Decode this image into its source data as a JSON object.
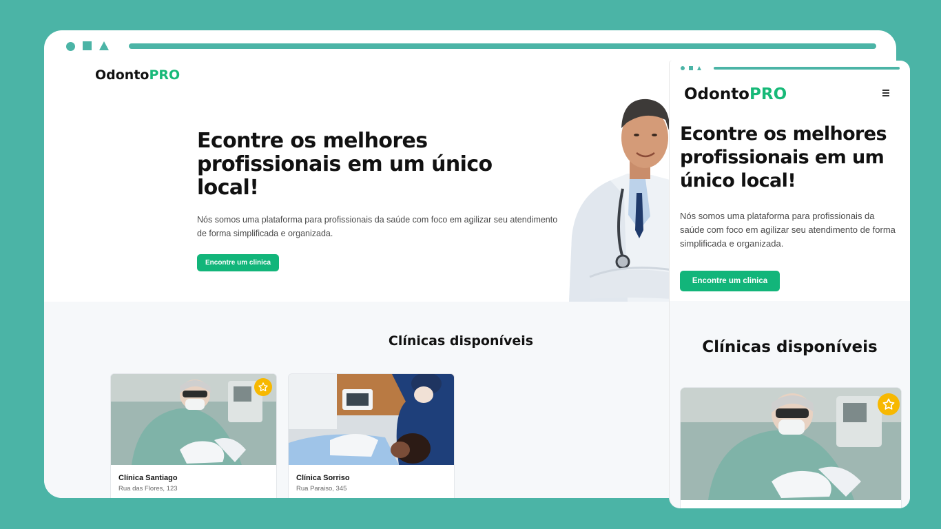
{
  "brand": {
    "name_prefix": "Odonto",
    "name_suffix": "PRO"
  },
  "hero": {
    "title": "Econtre os melhores profissionais em um único local!",
    "description": "Nós somos uma plataforma para profissionais da saúde com foco em agilizar seu atendimento de forma simplificada e organizada.",
    "cta_label": "Encontre um clinica"
  },
  "clinics_section": {
    "title": "Clínicas disponíveis",
    "cards": [
      {
        "name": "Clínica Santiago",
        "address": "Rua das Flores, 123",
        "favorite": true
      },
      {
        "name": "Clínica Sorriso",
        "address": "Rua Paraiso, 345",
        "favorite": false
      }
    ]
  },
  "colors": {
    "background": "#4bb4a6",
    "accent_green": "#12b57a",
    "brand_pro": "#17b978",
    "star_badge": "#f7b800"
  },
  "icons": {
    "menu": "hamburger-icon",
    "favorite": "star-icon"
  }
}
